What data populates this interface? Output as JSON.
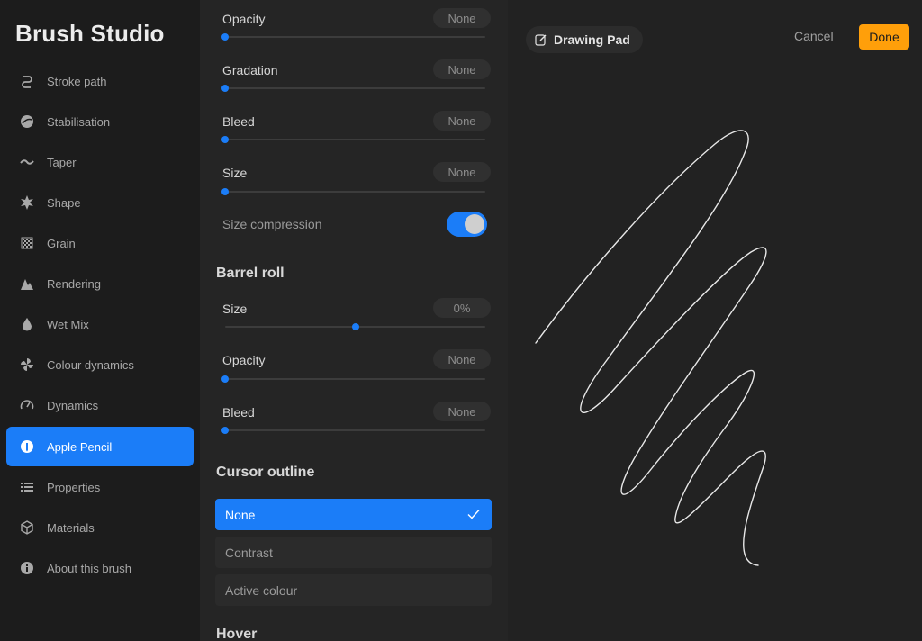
{
  "sidebar": {
    "title": "Brush Studio",
    "items": [
      {
        "label": "Stroke path",
        "icon": "stroke-path-icon"
      },
      {
        "label": "Stabilisation",
        "icon": "stabilisation-icon"
      },
      {
        "label": "Taper",
        "icon": "taper-icon"
      },
      {
        "label": "Shape",
        "icon": "shape-icon"
      },
      {
        "label": "Grain",
        "icon": "grain-icon"
      },
      {
        "label": "Rendering",
        "icon": "rendering-icon"
      },
      {
        "label": "Wet Mix",
        "icon": "wet-mix-icon"
      },
      {
        "label": "Colour dynamics",
        "icon": "colour-dynamics-icon"
      },
      {
        "label": "Dynamics",
        "icon": "dynamics-icon"
      },
      {
        "label": "Apple Pencil",
        "icon": "apple-pencil-icon",
        "active": true
      },
      {
        "label": "Properties",
        "icon": "properties-icon"
      },
      {
        "label": "Materials",
        "icon": "materials-icon"
      },
      {
        "label": "About this brush",
        "icon": "info-icon"
      }
    ]
  },
  "pressure": {
    "opacity": {
      "label": "Opacity",
      "value": "None",
      "level": 0
    },
    "gradation": {
      "label": "Gradation",
      "value": "None",
      "level": 0
    },
    "bleed": {
      "label": "Bleed",
      "value": "None",
      "level": 0
    },
    "size": {
      "label": "Size",
      "value": "None",
      "level": 0
    },
    "size_compression": {
      "label": "Size compression",
      "enabled": true
    }
  },
  "barrel_roll": {
    "title": "Barrel roll",
    "size": {
      "label": "Size",
      "value": "0%",
      "level": 0.5
    },
    "opacity": {
      "label": "Opacity",
      "value": "None",
      "level": 0
    },
    "bleed": {
      "label": "Bleed",
      "value": "None",
      "level": 0
    }
  },
  "cursor_outline": {
    "title": "Cursor outline",
    "options": [
      {
        "label": "None",
        "selected": true
      },
      {
        "label": "Contrast",
        "selected": false
      },
      {
        "label": "Active colour",
        "selected": false
      }
    ]
  },
  "hover": {
    "title": "Hover"
  },
  "drawing_pad": {
    "title": "Drawing Pad",
    "cancel_label": "Cancel",
    "done_label": "Done"
  },
  "colors": {
    "accent": "#1b7df8",
    "done": "#ff9f0a",
    "background": "#1e1e1e"
  }
}
